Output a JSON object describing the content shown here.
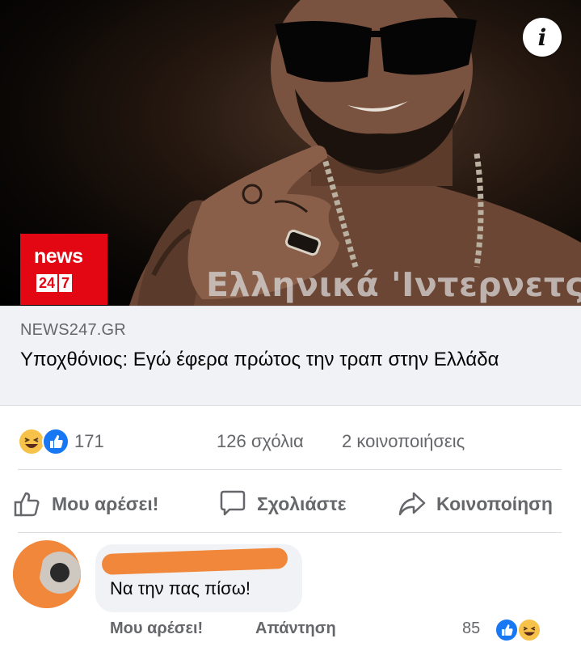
{
  "preview": {
    "info_icon": "info-icon",
    "logo_top": "news",
    "logo_bottom": [
      "24",
      "7"
    ],
    "watermark": "Ελληνικά 'Ιντερνετς",
    "domain": "NEWS247.GR",
    "headline": "Υποχθόνιος: Εγώ έφερα πρώτος την τραπ στην Ελλάδα"
  },
  "stats": {
    "reaction_icons": [
      "haha-icon",
      "like-icon"
    ],
    "reaction_count": "171",
    "comments": "126 σχόλια",
    "shares": "2 κοινοποιήσεις"
  },
  "actions": {
    "like": "Μου αρέσει!",
    "comment": "Σχολιάστε",
    "share": "Κοινοποίηση"
  },
  "comment": {
    "text": "Να την πας πίσω!",
    "like": "Μου αρέσει!",
    "reply": "Απάντηση",
    "reaction_count": "85"
  },
  "colors": {
    "like_blue": "#1877f2",
    "haha_yellow": "#f7c24a",
    "news_red": "#e30613",
    "redaction_orange": "#f0873a",
    "secondary_text": "#65676b"
  }
}
